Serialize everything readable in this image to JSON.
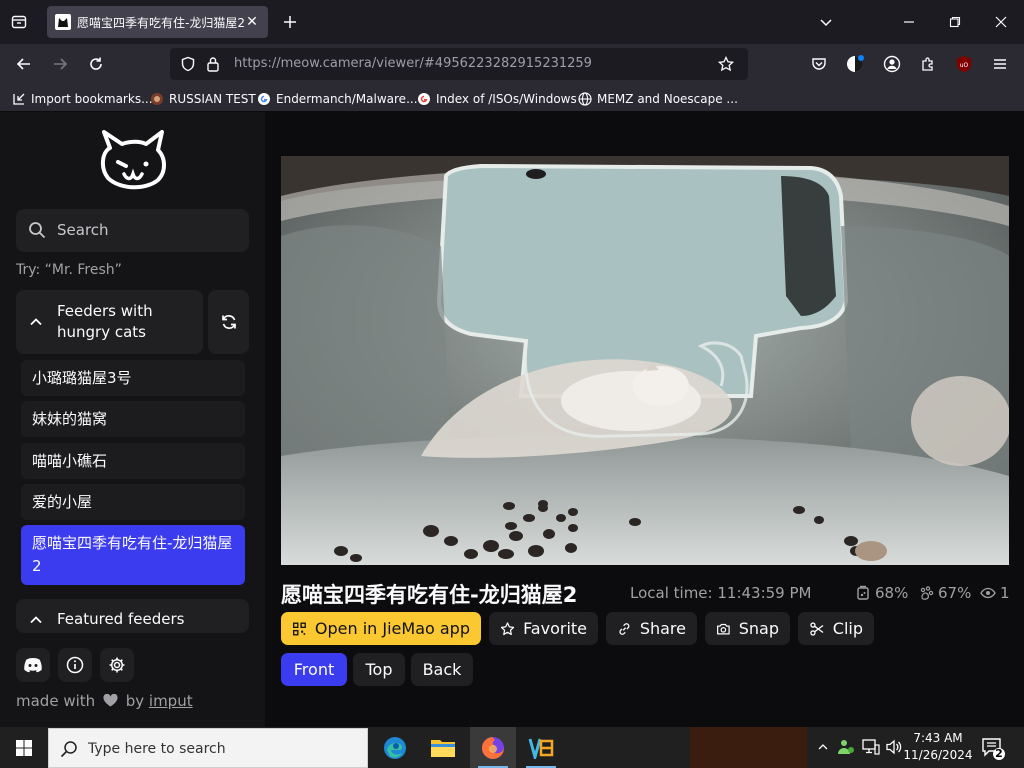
{
  "browser": {
    "tab_title": "愿喵宝四季有吃有住-龙归猫屋2",
    "tab_close": "✕",
    "url_host": "https://meow.camera",
    "url_path": "/viewer/#4956223282915231259",
    "bookmarks": [
      {
        "label": "Import bookmarks...",
        "icon": "import-icon"
      },
      {
        "label": "RUSSIAN TEST",
        "icon": "site-favicon"
      },
      {
        "label": "Endermanch/Malware...",
        "icon": "google-favicon"
      },
      {
        "label": "Index of /ISOs/Windows",
        "icon": "google-favicon"
      },
      {
        "label": "MEMZ and Noescape ...",
        "icon": "globe-icon"
      }
    ]
  },
  "sidebar": {
    "search_placeholder": "Search",
    "try_hint": "Try: “Mr. Fresh”",
    "group_hungry": "Feeders with hungry cats",
    "feeders": [
      "小璐璐猫屋3号",
      "妹妹的猫窝",
      "喵喵小礁石",
      "爱的小屋",
      "愿喵宝四季有吃有住-龙归猫屋2"
    ],
    "active_feeder_index": 4,
    "group_featured": "Featured feeders",
    "made_with_prefix": "made with",
    "made_with_by": "by",
    "made_with_author": "imput"
  },
  "viewer": {
    "feeder_title": "愿喵宝四季有吃有住-龙归猫屋2",
    "local_time": "Local time: 11:43:59 PM",
    "food_level": "68%",
    "battery_level": "67%",
    "viewers": "1",
    "actions": {
      "open_app": "Open in JieMao app",
      "favorite": "Favorite",
      "share": "Share",
      "snap": "Snap",
      "clip": "Clip"
    },
    "views": [
      "Front",
      "Top",
      "Back"
    ],
    "active_view": "Front"
  },
  "taskbar": {
    "search_placeholder": "Type here to search",
    "time": "7:43 AM",
    "date": "11/26/2024",
    "notification_count": "2"
  },
  "colors": {
    "accent": "#3b3bf0",
    "app_button": "#fbc832",
    "sidebar": "#141416"
  }
}
